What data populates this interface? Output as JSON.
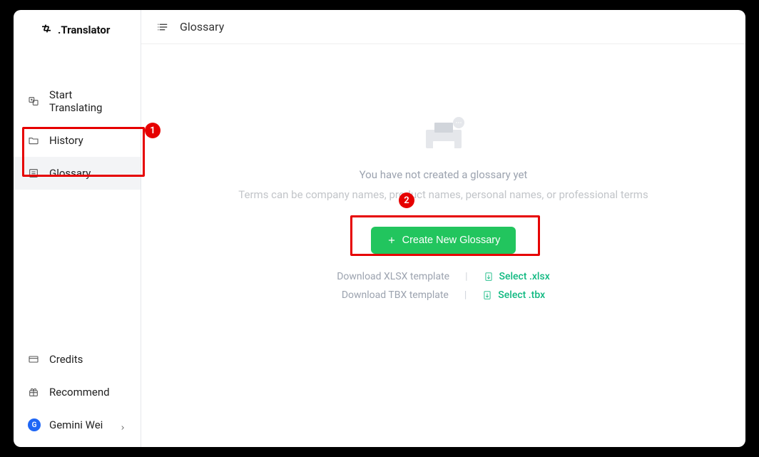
{
  "brand": {
    "name": ".Translator"
  },
  "sidebar": {
    "items": [
      {
        "label": "Start Translating",
        "icon": "translate"
      },
      {
        "label": "History",
        "icon": "folder"
      },
      {
        "label": "Glossary",
        "icon": "list-box",
        "active": true
      }
    ],
    "bottom": [
      {
        "label": "Credits",
        "icon": "card"
      },
      {
        "label": "Recommend",
        "icon": "gift"
      }
    ],
    "user": {
      "name": "Gemini Wei",
      "initial": "G"
    }
  },
  "header": {
    "title": "Glossary"
  },
  "empty": {
    "title": "You have not created a glossary yet",
    "subtitle": "Terms can be company names, product names, personal names, or professional terms",
    "create_label": "Create New Glossary"
  },
  "downloads": [
    {
      "label": "Download XLSX template",
      "link": "Select .xlsx"
    },
    {
      "label": "Download TBX template",
      "link": "Select .tbx"
    }
  ],
  "annotations": [
    {
      "badge": "1"
    },
    {
      "badge": "2"
    }
  ]
}
